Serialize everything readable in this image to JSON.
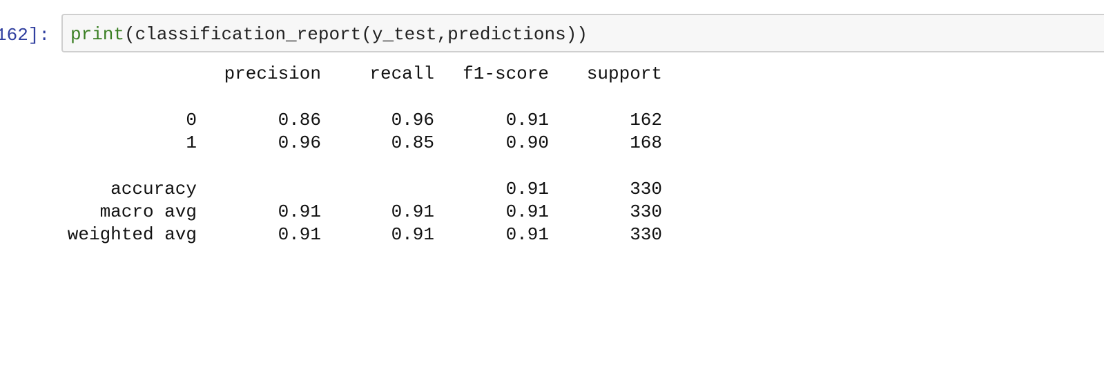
{
  "cell": {
    "prompt": "162]:",
    "code": {
      "func": "print",
      "rest": "(classification_report(y_test,predictions))"
    }
  },
  "report": {
    "header": [
      "",
      "precision",
      "recall",
      "f1-score",
      "support"
    ],
    "rows": [
      [
        "0",
        "0.86",
        "0.96",
        "0.91",
        "162"
      ],
      [
        "1",
        "0.96",
        "0.85",
        "0.90",
        "168"
      ],
      [
        "accuracy",
        "",
        "",
        "0.91",
        "330"
      ],
      [
        "macro avg",
        "0.91",
        "0.91",
        "0.91",
        "330"
      ],
      [
        "weighted avg",
        "0.91",
        "0.91",
        "0.91",
        "330"
      ]
    ]
  }
}
